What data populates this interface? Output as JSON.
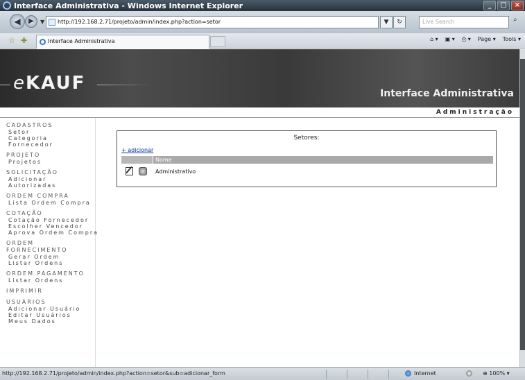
{
  "window": {
    "title": "Interface Administrativa - Windows Internet Explorer",
    "min": "_",
    "max": "□",
    "close": "×"
  },
  "nav": {
    "back": "◀",
    "forward": "▶",
    "dropdown": "▼",
    "address": "http://192.168.2.71/projeto/admin/index.php?action=setor",
    "refresh": "↻",
    "stop": "×",
    "go_dd": "▼",
    "search_placeholder": "Live Search",
    "search_icon": "⌕"
  },
  "tabbar": {
    "fav_star": "☆",
    "fav_add": "✚",
    "tab_title": "Interface Administrativa",
    "commands": [
      "⌂ ▾",
      "▣ ▾",
      "⎙ ▾",
      "Page ▾",
      "Tools ▾"
    ]
  },
  "header": {
    "logo_e": "e",
    "logo_rest": "KAUF",
    "title": "Interface Administrativa",
    "subtitle": "Administração"
  },
  "sidebar": {
    "sections": [
      {
        "title": "CADASTROS",
        "items": [
          "Setor",
          "Categoria",
          "Fornecedor"
        ]
      },
      {
        "title": "PROJETO",
        "items": [
          "Projetos"
        ]
      },
      {
        "title": "SOLICITAÇÃO",
        "items": [
          "Adicionar",
          "Autorizadas"
        ]
      },
      {
        "title": "ORDEM COMPRA",
        "items": [
          "Lista Ordem Compra"
        ]
      },
      {
        "title": "COTAÇÃO",
        "items": [
          "Cotação Fornecedor",
          "Escolher Vencedor",
          "Aprova Ordem Compra"
        ]
      },
      {
        "title": "ORDEM FORNECIMENTO",
        "items": [
          "Gerar Ordem",
          "Listar Ordens"
        ]
      },
      {
        "title": "ORDEM PAGAMENTO",
        "items": [
          "Listar Ordens"
        ]
      },
      {
        "title": "IMPRIMIR",
        "items": []
      },
      {
        "title": "USUÁRIOS",
        "items": [
          "Adicionar Usuário",
          "Editar Usuários",
          "Meus Dados"
        ]
      }
    ]
  },
  "content": {
    "title": "Setores:",
    "add_link": "+ adicionar",
    "column": "Nome",
    "rows": [
      {
        "nome": "Administrativo"
      }
    ]
  },
  "status": {
    "url": "http://192.168.2.71/projeto/admin/index.php?action=setor&sub=adicionar_form",
    "zone": "Internet",
    "zoom": "100%"
  }
}
